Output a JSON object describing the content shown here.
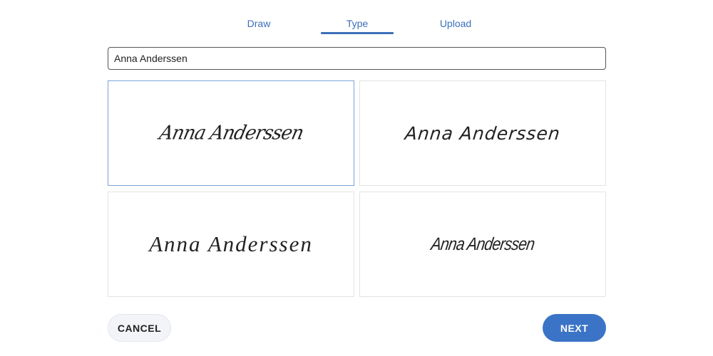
{
  "tabs": [
    {
      "label": "Draw",
      "active": false
    },
    {
      "label": "Type",
      "active": true
    },
    {
      "label": "Upload",
      "active": false
    }
  ],
  "name_input": {
    "value": "Anna Anderssen"
  },
  "signature_options": [
    {
      "text": "Anna Anderssen",
      "selected": true
    },
    {
      "text": "Anna Anderssen",
      "selected": false
    },
    {
      "text": "Anna Anderssen",
      "selected": false
    },
    {
      "text": "Anna Anderssen",
      "selected": false
    }
  ],
  "buttons": {
    "cancel_label": "CANCEL",
    "next_label": "NEXT"
  },
  "colors": {
    "accent": "#3b6fba",
    "primary_button": "#3b74c7",
    "secondary_button": "#f2f4f7",
    "selected_border": "#7aa2d8"
  }
}
